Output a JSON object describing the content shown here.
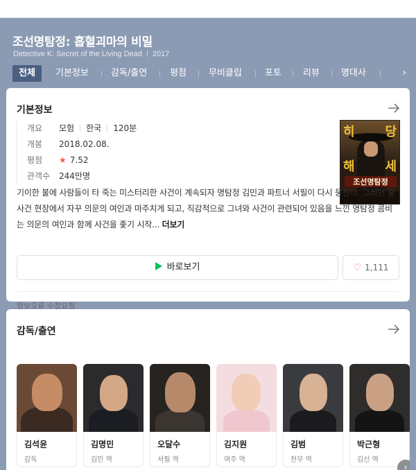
{
  "movie": {
    "title": "조선명탐정: 흡혈괴마의 비밀",
    "english_title": "Detective K: Secret of the Living Dead",
    "year": "2017"
  },
  "tabs": [
    "전체",
    "기본정보",
    "감독/출연",
    "평점",
    "무비클립",
    "포토",
    "리뷰",
    "명대사"
  ],
  "basic_info": {
    "section_title": "기본정보",
    "rows": {
      "overview_label": "개요",
      "genre": "모험",
      "country": "한국",
      "runtime": "120분",
      "release_label": "개봉",
      "release_date": "2018.02.08.",
      "rating_label": "평점",
      "rating": "7.52",
      "audience_label": "관객수",
      "audience": "244만명"
    },
    "poster_text": {
      "top_left": "히",
      "top_right": "당",
      "mid_left": "해",
      "mid_right": "세",
      "title": "조선명탐정"
    },
    "summary": "기이한 불에 사람들이 타 죽는 미스터리한 사건이 계속되자 명탐정 김민과 파트너 서필이 다시 뭉친다. 그러던 중 사건 현장에서 자꾸 의문의 여인과 마주치게 되고, 직감적으로 그녀와 사건이 관련되어 있음을 느낀 명탐정 콤비는 의문의 여인과 함께 사건을 좇기 시작...",
    "more_label": "더보기",
    "watch_label": "바로보기",
    "like_count": "1,111",
    "report_label": "정보오류 수정요청"
  },
  "cast_section": {
    "section_title": "감독/출연",
    "people": [
      {
        "name": "김석윤",
        "role": "감독"
      },
      {
        "name": "김명민",
        "role": "김민 역"
      },
      {
        "name": "오달수",
        "role": "서필 역"
      },
      {
        "name": "김지원",
        "role": "여주 역"
      },
      {
        "name": "김범",
        "role": "천무 역"
      },
      {
        "name": "박근형",
        "role": "김신 역"
      }
    ]
  },
  "colors": {
    "header_bg": "#8c9bb4",
    "active_tab": "#4b5f80",
    "naver_green": "#03c75a",
    "star": "#f25b4b"
  }
}
